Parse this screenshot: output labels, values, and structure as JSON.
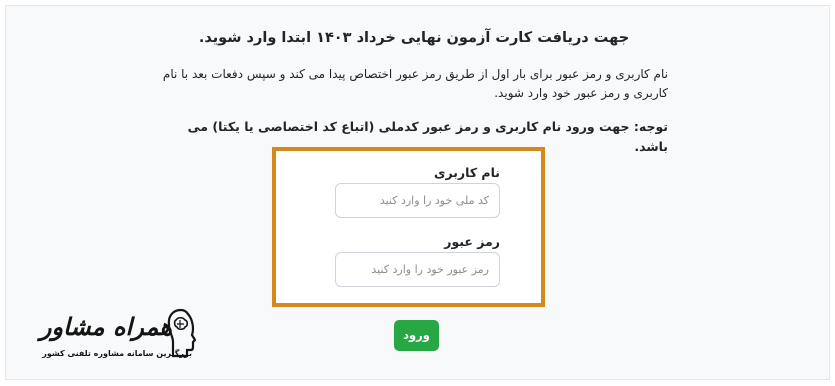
{
  "page": {
    "title": "جهت دریافت کارت آزمون نهایی خرداد ۱۴۰۳ ابتدا وارد شوید.",
    "description": "نام کاربری و رمز عبور برای بار اول از طریق رمز عبور اختصاص پیدا می کند و سپس دفعات بعد با نام کاربری و رمز عبور خود وارد شوید.",
    "note": "توجه: جهت ورود نام کاربری و رمز عبور کدملی (اتباع کد اختصاصی یا یکتا) می باشد."
  },
  "form": {
    "username_label": "نام کاربری",
    "username_placeholder": "کد ملی خود را وارد کنید",
    "password_label": "رمز عبور",
    "password_placeholder": "رمز عبور خود را وارد کنید",
    "submit_label": "ورود"
  },
  "watermark": {
    "brand": "همراه مشاور",
    "tagline": "بزرگترین سامانه مشاوره تلفنی کشور",
    "icon": "brain-head-icon"
  },
  "colors": {
    "highlight_border": "#d4891c",
    "submit_button": "#28a745",
    "panel_background": "#f8f9fa"
  }
}
